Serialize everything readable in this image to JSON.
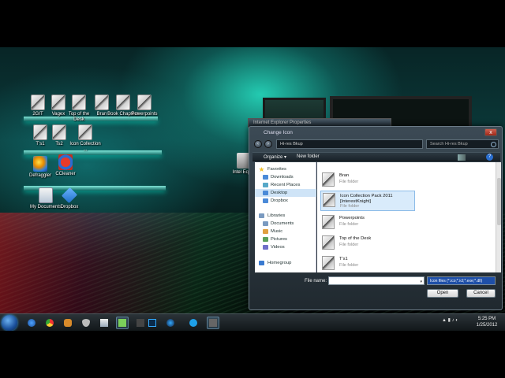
{
  "desktop_icons": [
    {
      "label": "2GIT"
    },
    {
      "label": "Vagex"
    },
    {
      "label": "Top of the Desk"
    },
    {
      "label": "Bran"
    },
    {
      "label": "Book Chapters"
    },
    {
      "label": "Powerpoints"
    },
    {
      "label": "T's1"
    },
    {
      "label": "Ts2"
    },
    {
      "label": "Icon Collection ..."
    },
    {
      "label": "Defraggler"
    },
    {
      "label": "CCleaner"
    },
    {
      "label": "My Documents"
    },
    {
      "label": "Dropbox"
    },
    {
      "label": "Intel Equ..."
    }
  ],
  "background_window": {
    "title": "Internet Explorer Properties"
  },
  "dialog": {
    "title": "Change Icon",
    "close": "x",
    "address": "Hi-res Bkup",
    "search_placeholder": "Search Hi-res Bkup",
    "toolbar": {
      "organize": "Organize ▾",
      "new_folder": "New folder",
      "help": "?"
    },
    "nav": [
      {
        "label": "Favorites",
        "icon": "star-icon",
        "head": true
      },
      {
        "label": "Downloads",
        "icon": "downloads-icon"
      },
      {
        "label": "Recent Places",
        "icon": "recent-places-icon"
      },
      {
        "label": "Desktop",
        "icon": "desktop-icon",
        "selected": true
      },
      {
        "label": "Dropbox",
        "icon": "dropbox-icon"
      },
      {
        "label": "Libraries",
        "icon": "libraries-icon",
        "head": true
      },
      {
        "label": "Documents",
        "icon": "documents-icon"
      },
      {
        "label": "Music",
        "icon": "music-icon"
      },
      {
        "label": "Pictures",
        "icon": "pictures-icon"
      },
      {
        "label": "Videos",
        "icon": "videos-icon"
      },
      {
        "label": "Homegroup",
        "icon": "homegroup-icon",
        "head": true
      }
    ],
    "files": [
      {
        "name": "Bran",
        "type": "File folder"
      },
      {
        "name": "Icon Collection Pack 2011 [InterestKnight]",
        "type": "File folder",
        "selected": true
      },
      {
        "name": "Powerpoints",
        "type": "File folder"
      },
      {
        "name": "Top of the Desk",
        "type": "File folder"
      },
      {
        "name": "T's1",
        "type": "File folder"
      }
    ],
    "filename_label": "File name:",
    "filename_value": "",
    "filetype": "Icon files (*.ico;*.icl;*.exe;*.dll)",
    "open_button": "Open",
    "cancel_button": "Cancel"
  },
  "taskbar": {
    "apps": [
      "internet-explorer-icon",
      "chrome-icon",
      "gimp-icon",
      "shield-icon",
      "notepad-icon",
      "explorer-icon",
      "blank",
      "photoshop-icon",
      "media-player-icon",
      "skype-icon",
      "camera-icon"
    ],
    "time": "5:25 PM",
    "date": "1/25/2012"
  }
}
